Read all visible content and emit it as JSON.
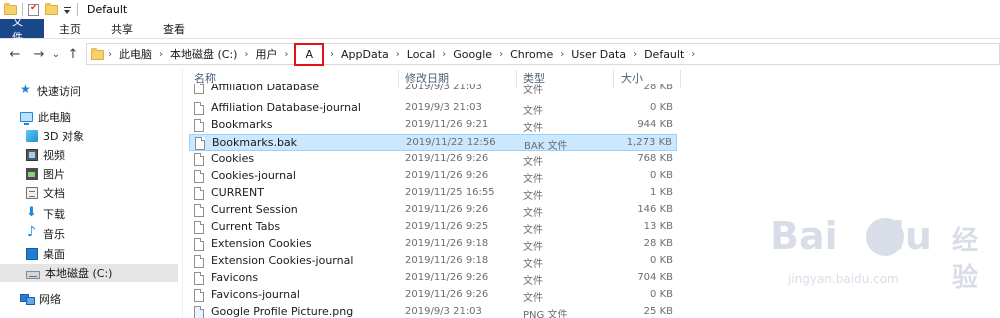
{
  "window": {
    "title": "Default"
  },
  "ribbon": {
    "tabs": [
      "文件",
      "主页",
      "共享",
      "查看"
    ]
  },
  "nav": {
    "back": "←",
    "forward": "→",
    "recent": "⌄",
    "up": "↑",
    "breadcrumbs": [
      "此电脑",
      "本地磁盘 (C:)",
      "用户",
      "A",
      "AppData",
      "Local",
      "Google",
      "Chrome",
      "User Data",
      "Default"
    ],
    "highlighted_crumb": "A",
    "highlight_color": "#e0121b"
  },
  "sidebar": {
    "items": [
      {
        "label": "快速访问",
        "icon": "star-icon"
      },
      {
        "label": "此电脑",
        "icon": "computer-icon"
      },
      {
        "label": "3D 对象",
        "icon": "cube-icon"
      },
      {
        "label": "视频",
        "icon": "video-icon"
      },
      {
        "label": "图片",
        "icon": "pictures-icon"
      },
      {
        "label": "文档",
        "icon": "documents-icon"
      },
      {
        "label": "下载",
        "icon": "download-icon"
      },
      {
        "label": "音乐",
        "icon": "music-icon"
      },
      {
        "label": "桌面",
        "icon": "desktop-icon"
      },
      {
        "label": "本地磁盘 (C:)",
        "icon": "drive-icon",
        "selected": true
      },
      {
        "label": "网络",
        "icon": "network-icon"
      }
    ]
  },
  "columns": {
    "name": "名称",
    "date": "修改日期",
    "type": "类型",
    "size": "大小"
  },
  "files": [
    {
      "name": "Affiliation Database",
      "date": "2019/9/3 21:03",
      "type": "文件",
      "size": "28 KB"
    },
    {
      "name": "Affiliation Database-journal",
      "date": "2019/9/3 21:03",
      "type": "文件",
      "size": "0 KB"
    },
    {
      "name": "Bookmarks",
      "date": "2019/11/26 9:21",
      "type": "文件",
      "size": "944 KB"
    },
    {
      "name": "Bookmarks.bak",
      "date": "2019/11/22 12:56",
      "type": "BAK 文件",
      "size": "1,273 KB",
      "selected": true
    },
    {
      "name": "Cookies",
      "date": "2019/11/26 9:26",
      "type": "文件",
      "size": "768 KB"
    },
    {
      "name": "Cookies-journal",
      "date": "2019/11/26 9:26",
      "type": "文件",
      "size": "0 KB"
    },
    {
      "name": "CURRENT",
      "date": "2019/11/25 16:55",
      "type": "文件",
      "size": "1 KB"
    },
    {
      "name": "Current Session",
      "date": "2019/11/26 9:26",
      "type": "文件",
      "size": "146 KB"
    },
    {
      "name": "Current Tabs",
      "date": "2019/11/26 9:25",
      "type": "文件",
      "size": "13 KB"
    },
    {
      "name": "Extension Cookies",
      "date": "2019/11/26 9:18",
      "type": "文件",
      "size": "28 KB"
    },
    {
      "name": "Extension Cookies-journal",
      "date": "2019/11/26 9:18",
      "type": "文件",
      "size": "0 KB"
    },
    {
      "name": "Favicons",
      "date": "2019/11/26 9:26",
      "type": "文件",
      "size": "704 KB"
    },
    {
      "name": "Favicons-journal",
      "date": "2019/11/26 9:26",
      "type": "文件",
      "size": "0 KB"
    },
    {
      "name": "Google Profile Picture.png",
      "date": "2019/9/3 21:03",
      "type": "PNG 文件",
      "size": "25 KB"
    }
  ],
  "colors": {
    "selection": "#cce8ff",
    "file_tab": "#19478a"
  },
  "watermark": {
    "brand": "Bai",
    "brand_tail": "du",
    "cn": "经验",
    "url": "jingyan.baidu.com"
  }
}
